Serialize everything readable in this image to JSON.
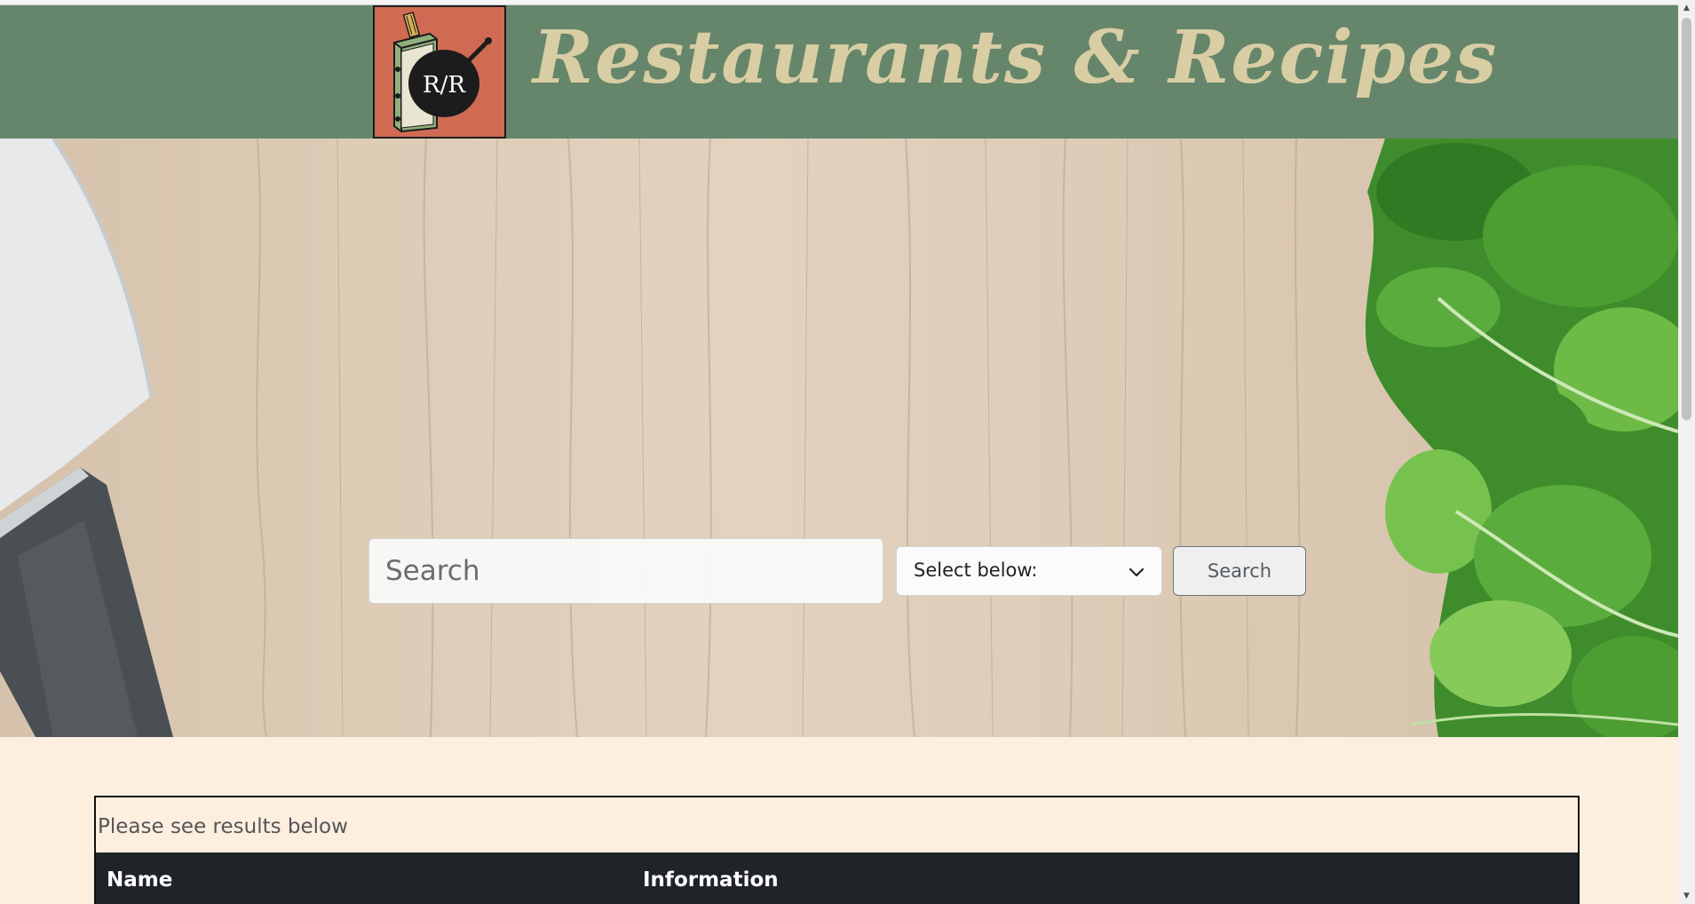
{
  "header": {
    "title": "Restaurants & Recipes",
    "logo_text": "R/R",
    "background_color": "#65866a",
    "logo_color": "#cf6b52",
    "title_color": "#d9cda4"
  },
  "hero": {
    "search_input": {
      "placeholder": "Search",
      "value": ""
    },
    "category_select": {
      "selected_label": "Select below:",
      "icon": "chevron-down-icon"
    },
    "search_button_label": "Search",
    "decor_icons": [
      "knife-icon",
      "parsley-icon"
    ]
  },
  "results": {
    "caption": "Please see results below",
    "columns": [
      "Name",
      "Information"
    ]
  },
  "colors": {
    "page_background": "#fdefe0",
    "table_header_background": "#202429"
  }
}
